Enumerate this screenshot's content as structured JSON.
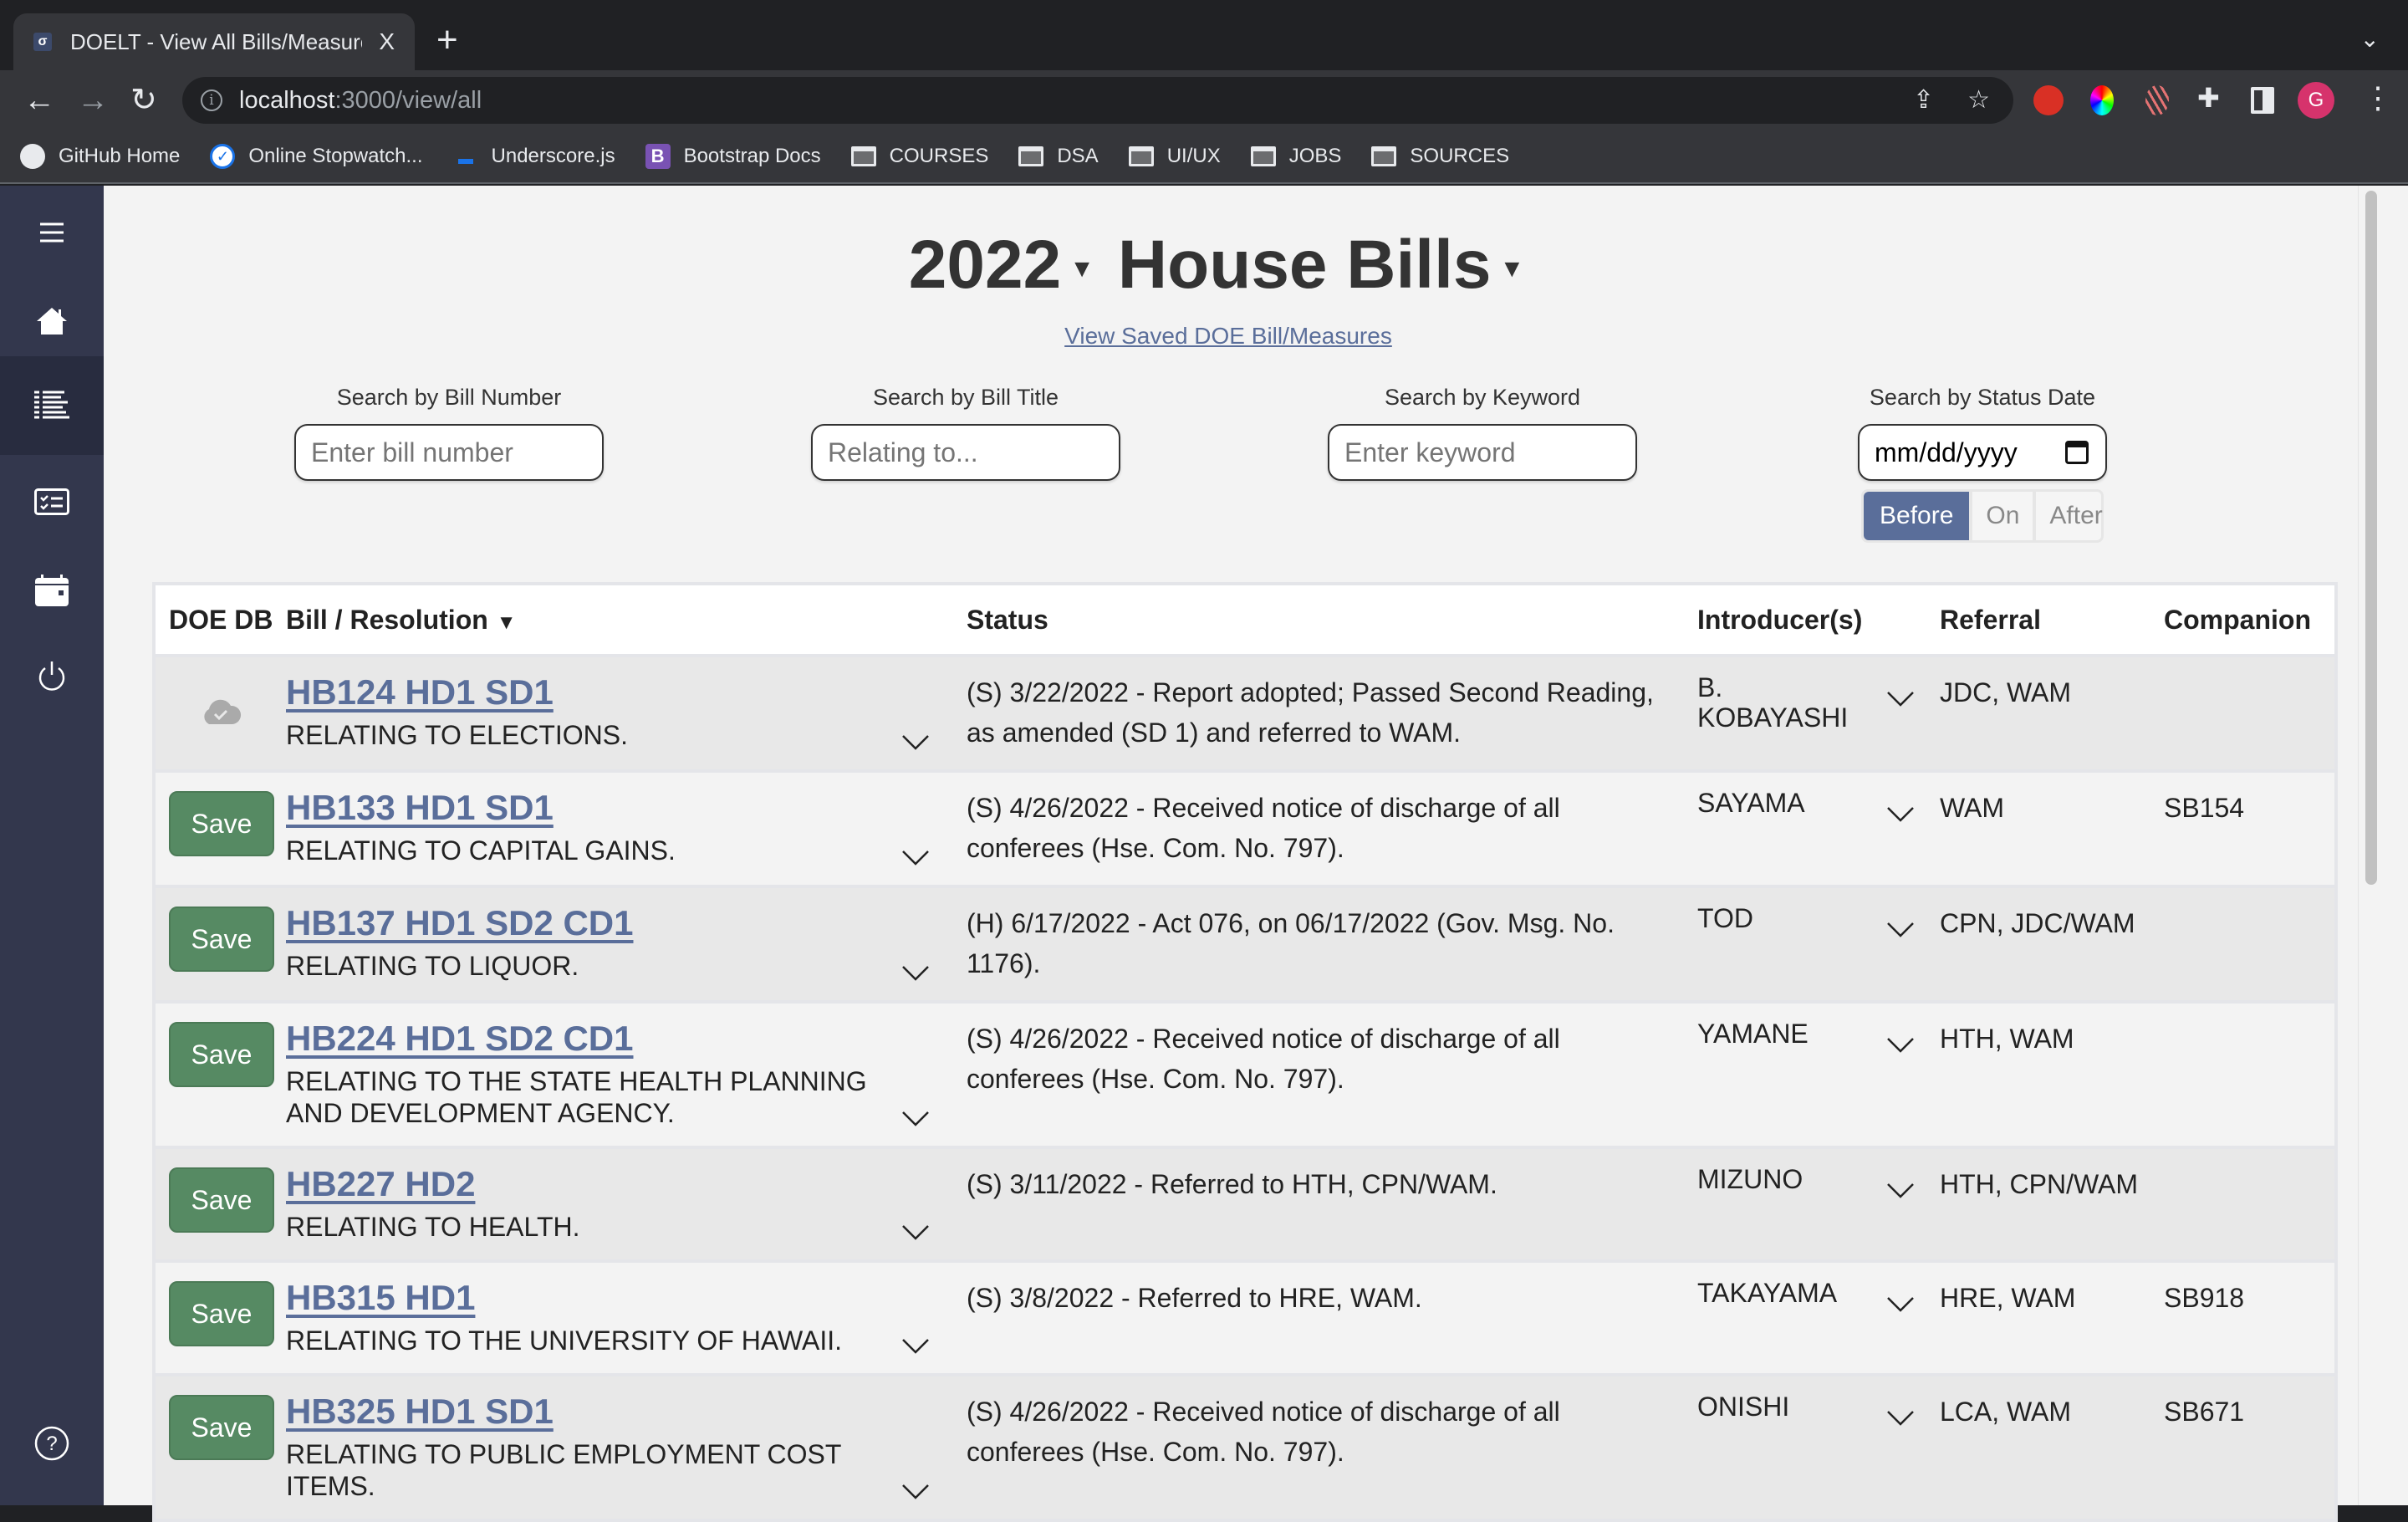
{
  "browser": {
    "tab_title": "DOELT - View All Bills/Measures",
    "tab_close": "X",
    "new_tab": "+",
    "url_host": "localhost",
    "url_path": ":3000/view/all",
    "avatar_letter": "G",
    "bookmarks": [
      {
        "label": "GitHub Home",
        "icon": "github-icon"
      },
      {
        "label": "Online Stopwatch...",
        "icon": "stopwatch-icon"
      },
      {
        "label": "Underscore.js",
        "icon": "underscore-icon"
      },
      {
        "label": "Bootstrap Docs",
        "icon": "bootstrap-icon"
      },
      {
        "label": "COURSES",
        "icon": "folder-icon"
      },
      {
        "label": "DSA",
        "icon": "folder-icon"
      },
      {
        "label": "UI/UX",
        "icon": "folder-icon"
      },
      {
        "label": "JOBS",
        "icon": "folder-icon"
      },
      {
        "label": "SOURCES",
        "icon": "folder-icon"
      }
    ]
  },
  "sidebar": {
    "items": [
      {
        "icon": "hamburger-menu-icon",
        "active": false
      },
      {
        "icon": "home-icon",
        "active": false
      },
      {
        "icon": "list-icon",
        "active": true
      },
      {
        "icon": "checklist-icon",
        "active": false
      },
      {
        "icon": "calendar-icon",
        "active": false
      },
      {
        "icon": "power-icon",
        "active": false
      },
      {
        "icon": "help-icon",
        "active": false
      }
    ]
  },
  "header": {
    "year": "2022",
    "chamber": "House Bills",
    "caret": "▾",
    "saved_link": "View Saved DOE Bill/Measures"
  },
  "search": {
    "bill_number": {
      "label": "Search by Bill Number",
      "placeholder": "Enter bill number",
      "value": ""
    },
    "bill_title": {
      "label": "Search by Bill Title",
      "placeholder": "Relating to...",
      "value": ""
    },
    "keyword": {
      "label": "Search by Keyword",
      "placeholder": "Enter keyword",
      "value": ""
    },
    "status_date": {
      "label": "Search by Status Date",
      "placeholder": "mm/dd/yyyy",
      "options": [
        "Before",
        "On",
        "After"
      ],
      "selected": "Before"
    }
  },
  "table": {
    "columns": [
      "DOE DB",
      "Bill / Resolution",
      "Status",
      "Introducer(s)",
      "Referral",
      "Companion"
    ],
    "sort_indicator": "▼",
    "save_label": "Save",
    "rows": [
      {
        "saved": true,
        "bill": "HB124 HD1 SD1",
        "title": "RELATING TO ELECTIONS.",
        "status": "(S) 3/22/2022 - Report adopted; Passed Second Reading, as amended (SD 1) and referred to WAM.",
        "introducer": "B. KOBAYASHI",
        "referral": "JDC, WAM",
        "companion": ""
      },
      {
        "saved": false,
        "bill": "HB133 HD1 SD1",
        "title": "RELATING TO CAPITAL GAINS.",
        "status": "(S) 4/26/2022 - Received notice of discharge of all conferees (Hse. Com. No. 797).",
        "introducer": "SAYAMA",
        "referral": "WAM",
        "companion": "SB154"
      },
      {
        "saved": false,
        "bill": "HB137 HD1 SD2 CD1",
        "title": "RELATING TO LIQUOR.",
        "status": "(H) 6/17/2022 - Act 076, on 06/17/2022 (Gov. Msg. No. 1176).",
        "introducer": "TOD",
        "referral": "CPN, JDC/WAM",
        "companion": ""
      },
      {
        "saved": false,
        "bill": "HB224 HD1 SD2 CD1",
        "title": "RELATING TO THE STATE HEALTH PLANNING AND DEVELOPMENT AGENCY.",
        "status": "(S) 4/26/2022 - Received notice of discharge of all conferees (Hse. Com. No. 797).",
        "introducer": "YAMANE",
        "referral": "HTH, WAM",
        "companion": ""
      },
      {
        "saved": false,
        "bill": "HB227 HD2",
        "title": "RELATING TO HEALTH.",
        "status": "(S) 3/11/2022 - Referred to HTH, CPN/WAM.",
        "introducer": "MIZUNO",
        "referral": "HTH, CPN/WAM",
        "companion": ""
      },
      {
        "saved": false,
        "bill": "HB315 HD1",
        "title": "RELATING TO THE UNIVERSITY OF HAWAII.",
        "status": "(S) 3/8/2022 - Referred to HRE, WAM.",
        "introducer": "TAKAYAMA",
        "referral": "HRE, WAM",
        "companion": "SB918"
      },
      {
        "saved": false,
        "bill": "HB325 HD1 SD1",
        "title": "RELATING TO PUBLIC EMPLOYMENT COST ITEMS.",
        "status": "(S) 4/26/2022 - Received notice of discharge of all conferees (Hse. Com. No. 797).",
        "introducer": "ONISHI",
        "referral": "LCA, WAM",
        "companion": "SB671"
      }
    ]
  }
}
